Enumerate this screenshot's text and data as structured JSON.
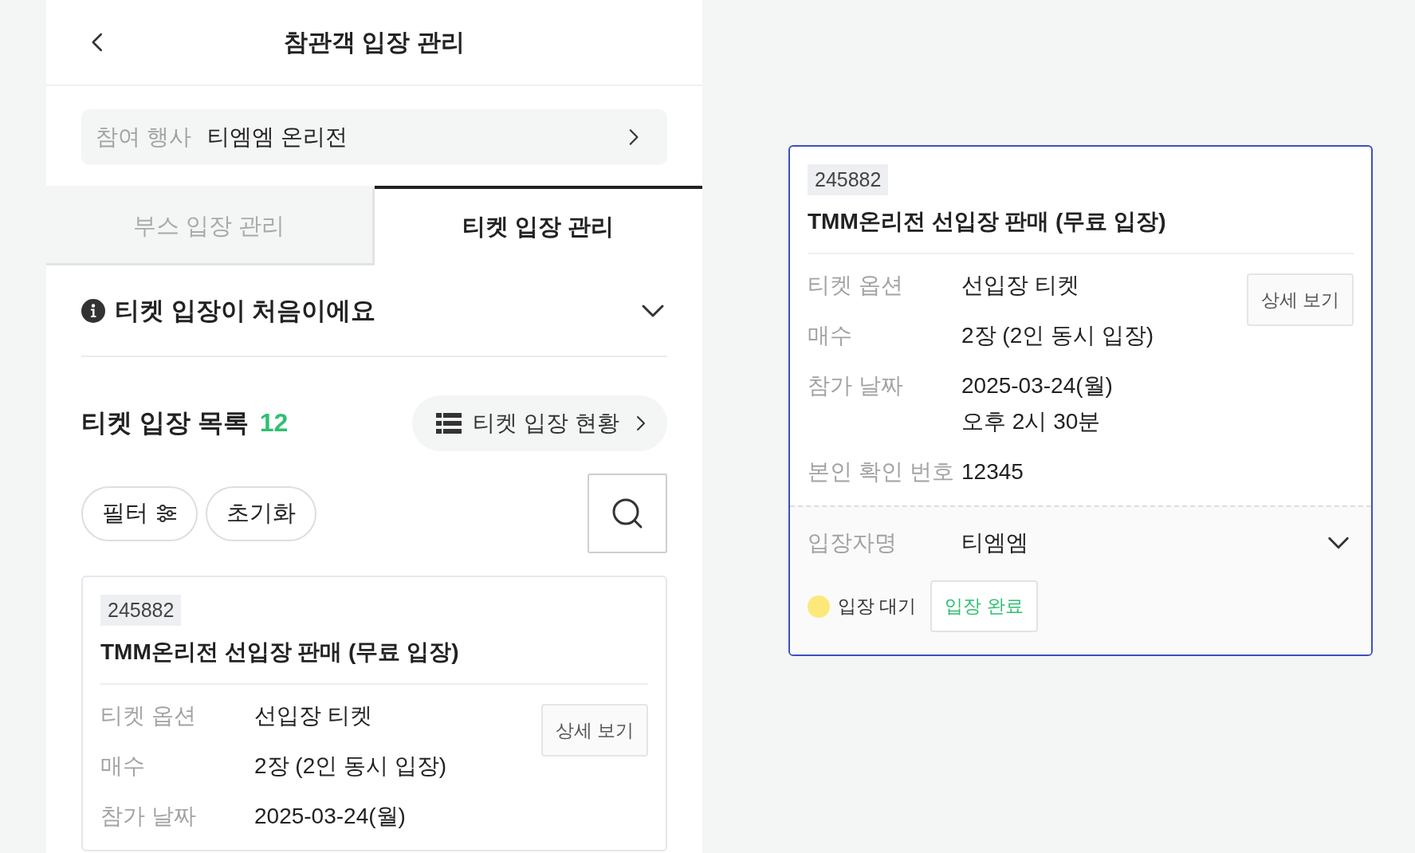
{
  "header": {
    "title": "참관객 입장 관리"
  },
  "event_selector": {
    "label": "참여 행사",
    "value": "티엠엠 온리전"
  },
  "tabs": [
    {
      "label": "부스 입장 관리",
      "selected": false
    },
    {
      "label": "티켓 입장 관리",
      "selected": true
    }
  ],
  "info": {
    "title": "티켓 입장이 처음이에요",
    "expanded": false
  },
  "list": {
    "title": "티켓 입장 목록",
    "count": "12",
    "status_button": "티켓 입장 현황",
    "filter_button": "필터",
    "reset_button": "초기화"
  },
  "cards": [
    {
      "id": "245882",
      "title": "TMM온리전 선입장 판매 (무료 입장)",
      "detail_button": "상세 보기",
      "highlighted": false,
      "rows": [
        {
          "label": "티켓 옵션",
          "values": [
            "선입장 티켓"
          ]
        },
        {
          "label": "매수",
          "values": [
            "2장 (2인 동시 입장)"
          ]
        },
        {
          "label": "참가 날짜",
          "values": [
            "2025-03-24(월)"
          ]
        }
      ]
    },
    {
      "id": "245882",
      "title": "TMM온리전 선입장 판매 (무료 입장)",
      "detail_button": "상세 보기",
      "highlighted": true,
      "rows": [
        {
          "label": "티켓 옵션",
          "values": [
            "선입장 티켓"
          ]
        },
        {
          "label": "매수",
          "values": [
            "2장 (2인 동시 입장)"
          ]
        },
        {
          "label": "참가 날짜",
          "values": [
            "2025-03-24(월)",
            "오후 2시 30분"
          ]
        },
        {
          "label": "본인 확인 번호",
          "values": [
            "12345"
          ]
        }
      ],
      "attendee": {
        "label": "입장자명",
        "name": "티엠엠",
        "expanded": false,
        "status": {
          "label": "입장 대기",
          "color": "#fde97a"
        },
        "complete_button": "입장 완료"
      }
    }
  ]
}
